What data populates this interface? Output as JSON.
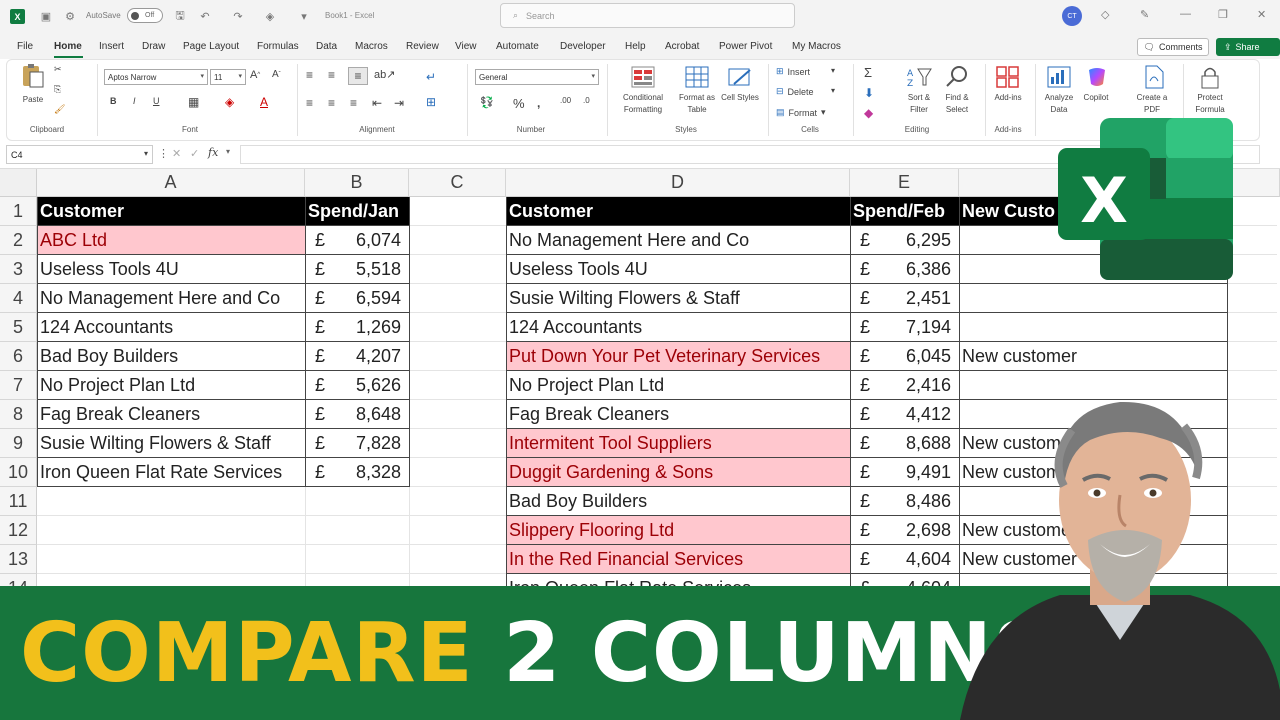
{
  "titlebar": {
    "autosave_label": "AutoSave",
    "autosave_state": "Off",
    "doc_title": "Book1 - Excel",
    "search_placeholder": "Search",
    "avatar_initials": "CT"
  },
  "menu": {
    "tabs": [
      "File",
      "Home",
      "Insert",
      "Draw",
      "Page Layout",
      "Formulas",
      "Data",
      "Macros",
      "Review",
      "View",
      "Automate",
      "Developer",
      "Help",
      "Acrobat",
      "Power Pivot",
      "My Macros"
    ],
    "active": "Home",
    "comments_label": "Comments",
    "share_label": "Share"
  },
  "ribbon": {
    "clipboard": {
      "paste": "Paste",
      "label": "Clipboard"
    },
    "font": {
      "name": "Aptos Narrow",
      "size": "11",
      "label": "Font",
      "bold": "B",
      "italic": "I",
      "underline": "U"
    },
    "alignment": {
      "label": "Alignment"
    },
    "number": {
      "format": "General",
      "label": "Number"
    },
    "styles": {
      "conditional": "Conditional Formatting",
      "format_table": "Format as Table",
      "cell_styles": "Cell Styles",
      "label": "Styles"
    },
    "cells": {
      "insert": "Insert",
      "delete": "Delete",
      "format": "Format",
      "label": "Cells"
    },
    "editing": {
      "sort_filter": "Sort & Filter",
      "find_select": "Find & Select",
      "label": "Editing"
    },
    "addins": {
      "addins": "Add-ins",
      "label": "Add-ins"
    },
    "analyze": "Analyze Data",
    "copilot": "Copilot",
    "create_pdf": "Create a PDF",
    "protect_formula": "Protect Formula"
  },
  "formula_bar": {
    "name_box": "C4",
    "fx": "fx",
    "content": ""
  },
  "columns": [
    "A",
    "B",
    "C",
    "D",
    "E"
  ],
  "rows": [
    "1",
    "2",
    "3",
    "4",
    "5",
    "6",
    "7",
    "8",
    "9",
    "10",
    "11",
    "12",
    "13",
    "14"
  ],
  "table1": {
    "headers": [
      "Customer",
      "Spend/Jan"
    ],
    "currency": "£",
    "rows": [
      {
        "customer": "ABC Ltd",
        "amount": "6,074",
        "highlight": true
      },
      {
        "customer": "Useless Tools 4U",
        "amount": "5,518",
        "highlight": false
      },
      {
        "customer": "No Management Here and Co",
        "amount": "6,594",
        "highlight": false
      },
      {
        "customer": "124 Accountants",
        "amount": "1,269",
        "highlight": false
      },
      {
        "customer": "Bad Boy Builders",
        "amount": "4,207",
        "highlight": false
      },
      {
        "customer": "No Project Plan Ltd",
        "amount": "5,626",
        "highlight": false
      },
      {
        "customer": "Fag Break Cleaners",
        "amount": "8,648",
        "highlight": false
      },
      {
        "customer": "Susie Wilting Flowers & Staff",
        "amount": "7,828",
        "highlight": false
      },
      {
        "customer": "Iron Queen Flat Rate Services",
        "amount": "8,328",
        "highlight": false
      }
    ]
  },
  "table2": {
    "headers": [
      "Customer",
      "Spend/Feb",
      "New Custo"
    ],
    "currency": "£",
    "rows": [
      {
        "customer": "No Management Here and Co",
        "amount": "6,295",
        "note": "",
        "highlight": false
      },
      {
        "customer": "Useless Tools 4U",
        "amount": "6,386",
        "note": "",
        "highlight": false
      },
      {
        "customer": "Susie Wilting Flowers & Staff",
        "amount": "2,451",
        "note": "",
        "highlight": false
      },
      {
        "customer": "124 Accountants",
        "amount": "7,194",
        "note": "",
        "highlight": false
      },
      {
        "customer": "Put Down Your Pet Veterinary Services",
        "amount": "6,045",
        "note": "New customer",
        "highlight": true
      },
      {
        "customer": "No Project Plan Ltd",
        "amount": "2,416",
        "note": "",
        "highlight": false
      },
      {
        "customer": "Fag Break Cleaners",
        "amount": "4,412",
        "note": "",
        "highlight": false
      },
      {
        "customer": "Intermitent Tool Suppliers",
        "amount": "8,688",
        "note": "New custome",
        "highlight": true
      },
      {
        "customer": "Duggit Gardening & Sons",
        "amount": "9,491",
        "note": "New custome",
        "highlight": true
      },
      {
        "customer": "Bad Boy Builders",
        "amount": "8,486",
        "note": "",
        "highlight": false
      },
      {
        "customer": "Slippery Flooring Ltd",
        "amount": "2,698",
        "note": "New custome",
        "highlight": true
      },
      {
        "customer": "In the Red Financial Services",
        "amount": "4,604",
        "note": "New customer",
        "highlight": true
      },
      {
        "customer": "Iron Queen Flat Rate Services",
        "amount": "4,604",
        "note": "",
        "highlight": false
      }
    ]
  },
  "banner": {
    "part1": "COMPARE",
    "part2": "2 COLUMNS"
  },
  "colors": {
    "excel_green": "#107c41",
    "banner_green": "#17763d",
    "banner_yellow": "#f2c01b",
    "pink_fill": "#ffc7ce",
    "pink_text": "#9c0006"
  }
}
